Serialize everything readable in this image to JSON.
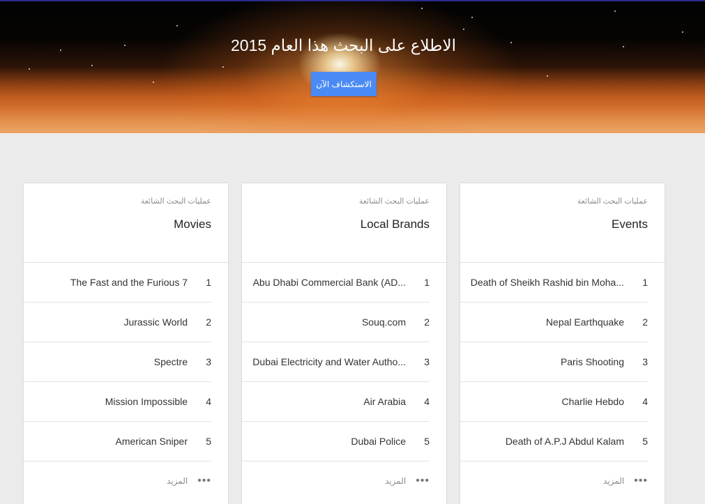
{
  "hero": {
    "title": "الاطلاع على البحث هذا العام 2015",
    "button_label": "الاستكشاف الآن"
  },
  "colors": {
    "accent": "#4a8af4",
    "background": "#ecebeb",
    "card": "#ffffff"
  },
  "cards": [
    {
      "subtitle": "عمليات البحث الشائعة",
      "title": "Movies",
      "items": [
        {
          "rank": "1",
          "label": "The Fast and the Furious 7"
        },
        {
          "rank": "2",
          "label": "Jurassic World"
        },
        {
          "rank": "3",
          "label": "Spectre"
        },
        {
          "rank": "4",
          "label": "Mission Impossible"
        },
        {
          "rank": "5",
          "label": "American Sniper"
        }
      ],
      "more_label": "المزيد",
      "more_icon": "more-horiz-icon"
    },
    {
      "subtitle": "عمليات البحث الشائعة",
      "title": "Local Brands",
      "items": [
        {
          "rank": "1",
          "label": "Abu Dhabi Commercial Bank (AD..."
        },
        {
          "rank": "2",
          "label": "Souq.com"
        },
        {
          "rank": "3",
          "label": "Dubai Electricity and Water Autho..."
        },
        {
          "rank": "4",
          "label": "Air Arabia"
        },
        {
          "rank": "5",
          "label": "Dubai Police"
        }
      ],
      "more_label": "المزيد",
      "more_icon": "more-horiz-icon"
    },
    {
      "subtitle": "عمليات البحث الشائعة",
      "title": "Events",
      "items": [
        {
          "rank": "1",
          "label": "Death of Sheikh Rashid bin Moha..."
        },
        {
          "rank": "2",
          "label": "Nepal Earthquake"
        },
        {
          "rank": "3",
          "label": "Paris Shooting"
        },
        {
          "rank": "4",
          "label": "Charlie Hebdo"
        },
        {
          "rank": "5",
          "label": "Death of A.P.J Abdul Kalam"
        }
      ],
      "more_label": "المزيد",
      "more_icon": "more-horiz-icon"
    }
  ]
}
